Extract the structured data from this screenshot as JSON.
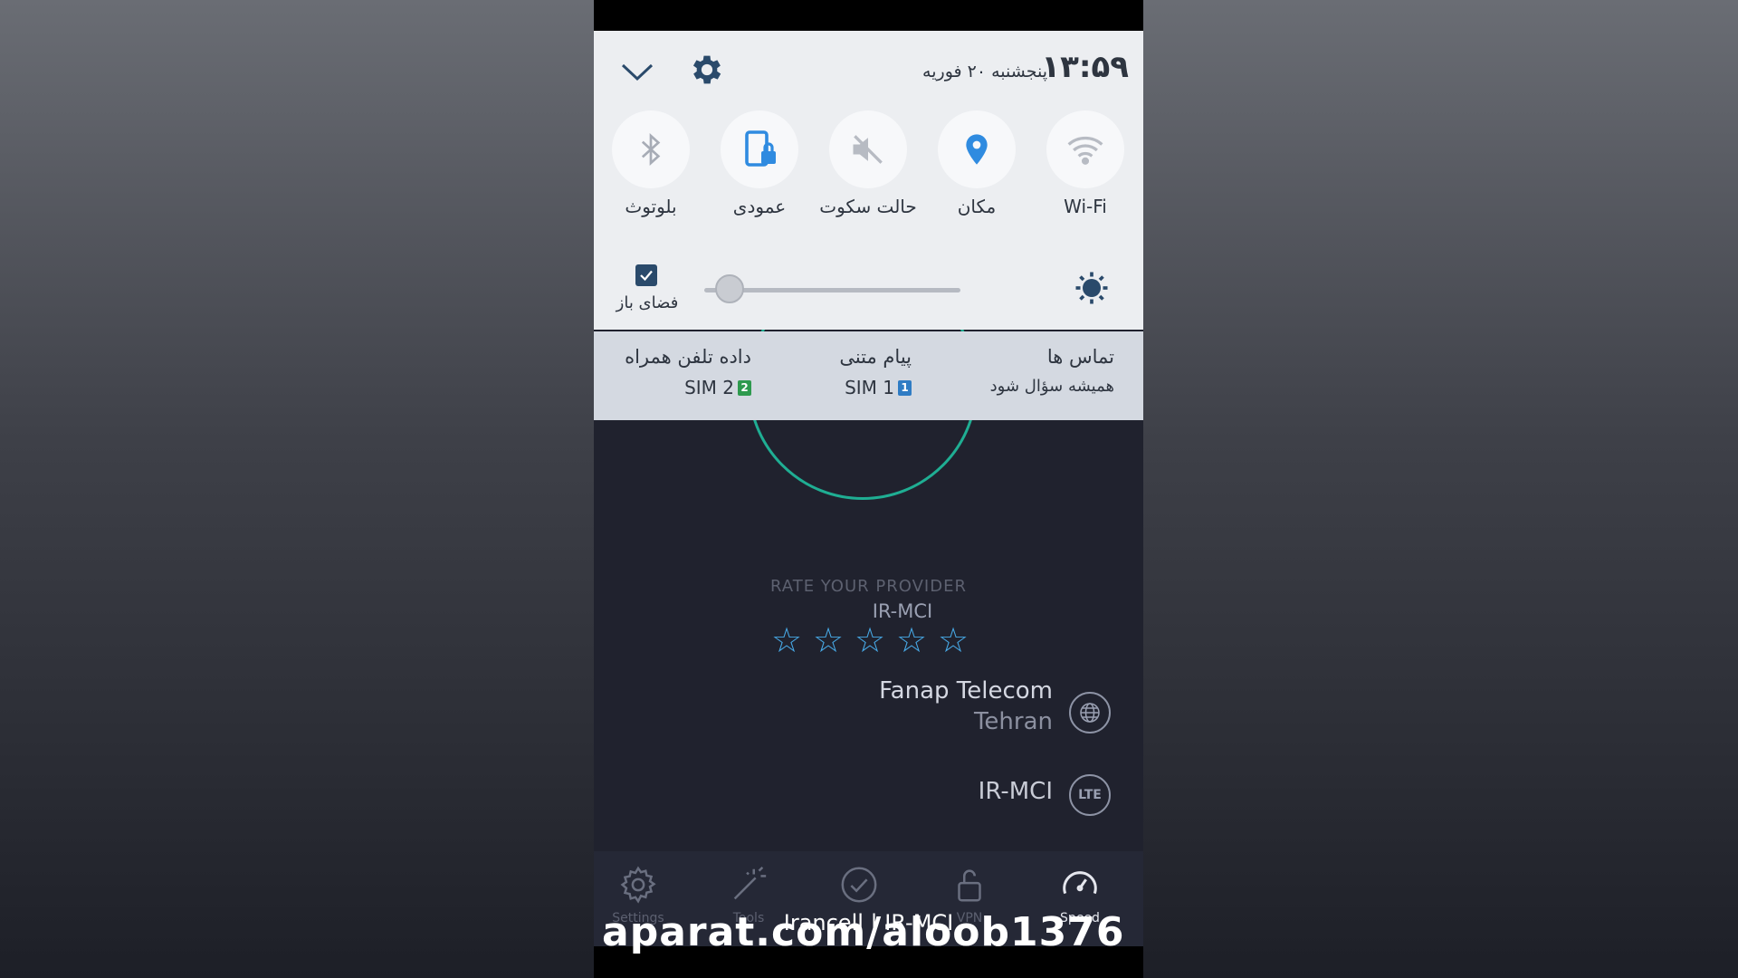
{
  "status": {
    "time": "۱۳:۵۹",
    "date": "پنجشنبه ۲۰ فوریه"
  },
  "quick_toggles": [
    {
      "label": "بلوتوث",
      "icon": "bluetooth-icon"
    },
    {
      "label": "عمودی",
      "icon": "screen-rotation-lock-icon"
    },
    {
      "label": "حالت سکوت",
      "icon": "mute-icon"
    },
    {
      "label": "مکان",
      "icon": "location-icon"
    },
    {
      "label": "Wi-Fi",
      "icon": "wifi-icon"
    }
  ],
  "brightness": {
    "level": 0.1,
    "outdoor_label": "فضای باز",
    "outdoor_checked": true
  },
  "sim_settings": [
    {
      "title": "داده تلفن همراه",
      "value": "SIM 2",
      "badge": "2",
      "badge_color": "#2e9a4e"
    },
    {
      "title": "پیام متنی",
      "value": "SIM 1",
      "badge": "1",
      "badge_color": "#2f7cc4"
    },
    {
      "title": "تماس ها",
      "value": "همیشه سؤال شود"
    }
  ],
  "app": {
    "rate_title": "RATE YOUR PROVIDER",
    "rate_provider": "IR-MCI",
    "stars_total": 5,
    "stars_filled": 0,
    "isp_name": "Fanap Telecom",
    "isp_city": "Tehran",
    "network_name": "IR-MCI",
    "network_type": "LTE"
  },
  "bottom_nav": [
    {
      "label": "Settings",
      "icon": "gear-icon"
    },
    {
      "label": "Tools",
      "icon": "magic-wand-icon"
    },
    {
      "label": "",
      "icon": "check-circle-icon"
    },
    {
      "label": "VPN",
      "icon": "lock-open-icon"
    },
    {
      "label": "Speed",
      "icon": "speedometer-icon"
    }
  ],
  "carrier_label": "Irancell | IR-MCI",
  "watermark": "aparat.com/aloob1376",
  "colors": {
    "accent_ring": "#1fae93",
    "star": "#47a9e6",
    "location_blue": "#2f8be0"
  }
}
